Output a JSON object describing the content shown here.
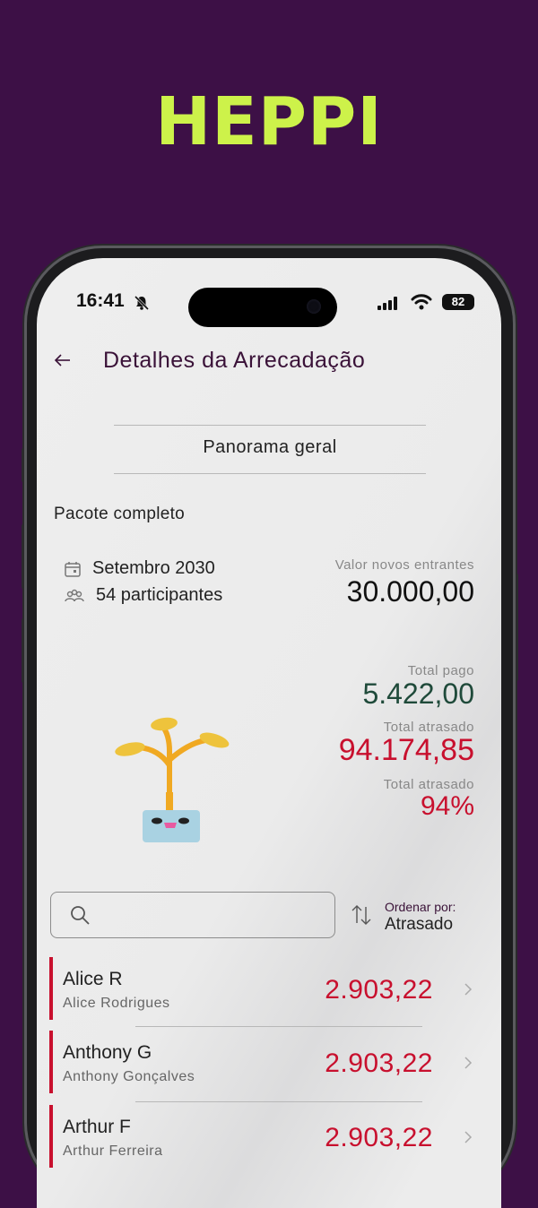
{
  "brand": {
    "logo_text": "HEPPI",
    "logo_color": "#cdf24a",
    "bg_color": "#3d1046"
  },
  "status_bar": {
    "time": "16:41",
    "battery": "82"
  },
  "header": {
    "title": "Detalhes da Arrecadação"
  },
  "tabs": {
    "active": "Panorama geral"
  },
  "package": {
    "name": "Pacote completo",
    "month": "Setembro 2030",
    "participants": "54 participantes",
    "new_entrants_label": "Valor novos entrantes",
    "new_entrants_value": "30.000,00"
  },
  "totals": {
    "paid_label": "Total pago",
    "paid_value": "5.422,00",
    "paid_color": "#1f4a3a",
    "late_label": "Total atrasado",
    "late_value": "94.174,85",
    "late_pct_label": "Total atrasado",
    "late_pct_value": "94%",
    "late_color": "#c8102e"
  },
  "search": {
    "placeholder": ""
  },
  "sort": {
    "label": "Ordenar por:",
    "value": "Atrasado"
  },
  "participants_list": [
    {
      "short": "Alice R",
      "full": "Alice Rodrigues",
      "amount": "2.903,22"
    },
    {
      "short": "Anthony G",
      "full": "Anthony Gonçalves",
      "amount": "2.903,22"
    },
    {
      "short": "Arthur F",
      "full": "Arthur Ferreira",
      "amount": "2.903,22"
    }
  ]
}
